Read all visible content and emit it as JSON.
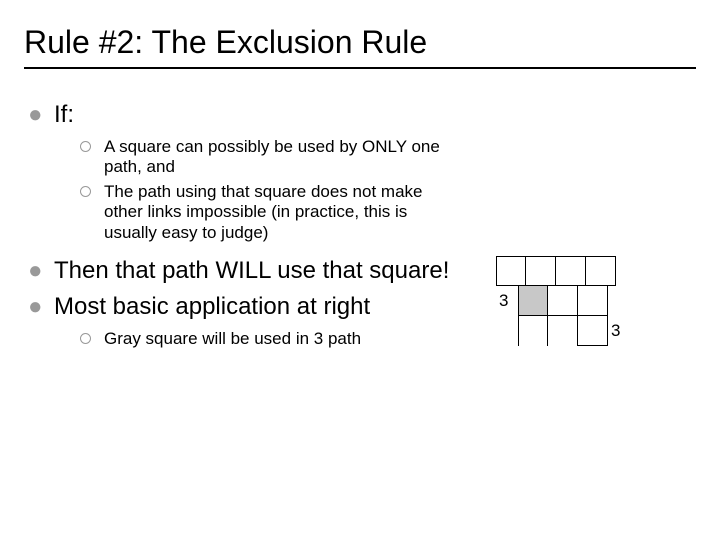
{
  "title": "Rule #2: The Exclusion Rule",
  "bullets": {
    "if": "If:",
    "if_sub1": "A square can possibly be used by ONLY one path, and",
    "if_sub2": "The path using that square does not make other links impossible (in practice, this is usually easy to judge)",
    "then": "Then that path WILL use that square!",
    "most": "Most basic application at right",
    "most_sub1": "Gray square will be used in 3 path"
  },
  "grid_labels": {
    "left": "3",
    "right": "3"
  }
}
